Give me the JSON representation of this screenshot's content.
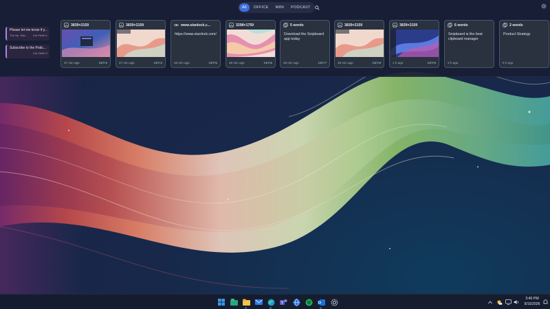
{
  "filters": {
    "items": [
      "All",
      "OFFICE",
      "MINI",
      "PODCAST"
    ],
    "active": "All",
    "search_icon": "search-icon"
  },
  "settings_icon": "gear-icon",
  "pinned": [
    {
      "title": "Please let me know if y...",
      "source": "The Ne, Stat...",
      "shortcut": "Ctrl+Shift+1"
    },
    {
      "title": "Subscribe to the Podc...",
      "source": "",
      "shortcut": "Ctrl+Shift+2"
    }
  ],
  "cards": [
    {
      "type": "image",
      "header": "3839×2159",
      "time": "37 min ago",
      "shortcut": "Ctrl+3",
      "thumb": "desktop"
    },
    {
      "type": "image",
      "header": "3839×2159",
      "time": "47 min ago",
      "shortcut": "Ctrl+4",
      "thumb": "swirl"
    },
    {
      "type": "link",
      "header": "www.stanlock.c...",
      "text": "https://www.stanlock.com/",
      "time": "48 min ago",
      "shortcut": "Ctrl+5"
    },
    {
      "type": "image",
      "header": "3298×1759",
      "time": "48 min ago",
      "shortcut": "Ctrl+6",
      "thumb": "swirl2"
    },
    {
      "type": "text",
      "header": "5 words",
      "text": "Download the Snipboard app today",
      "time": "48 min ago",
      "shortcut": "Ctrl+7"
    },
    {
      "type": "image",
      "header": "3839×2159",
      "time": "48 min ago",
      "shortcut": "Ctrl+8",
      "thumb": "swirl"
    },
    {
      "type": "image",
      "header": "3839×2159",
      "time": "1 h ago",
      "shortcut": "Ctrl+9",
      "thumb": "blue"
    },
    {
      "type": "text",
      "header": "6 words",
      "text": "Snipboard is the best clipboard manager",
      "time": "3 h ago",
      "shortcut": ""
    },
    {
      "type": "text",
      "header": "2 words",
      "text": "Product Strategy",
      "time": "6 h ago",
      "shortcut": ""
    }
  ],
  "taskbar": {
    "apps": [
      "windows-start",
      "file-explorer",
      "folder",
      "mail",
      "edge",
      "teams",
      "globe",
      "spotify",
      "outlook",
      "settings"
    ],
    "tray": [
      "chevron-up-icon",
      "weather-icon",
      "network-icon",
      "volume-icon",
      "notification-icon"
    ],
    "time": "3:40 PM",
    "date": "9/15/2026"
  },
  "colors": {
    "accent": "#3d6fe0",
    "pin_accent": "#a989e6",
    "card_border": "#48596a",
    "shortcut": "#a9d5d3"
  }
}
